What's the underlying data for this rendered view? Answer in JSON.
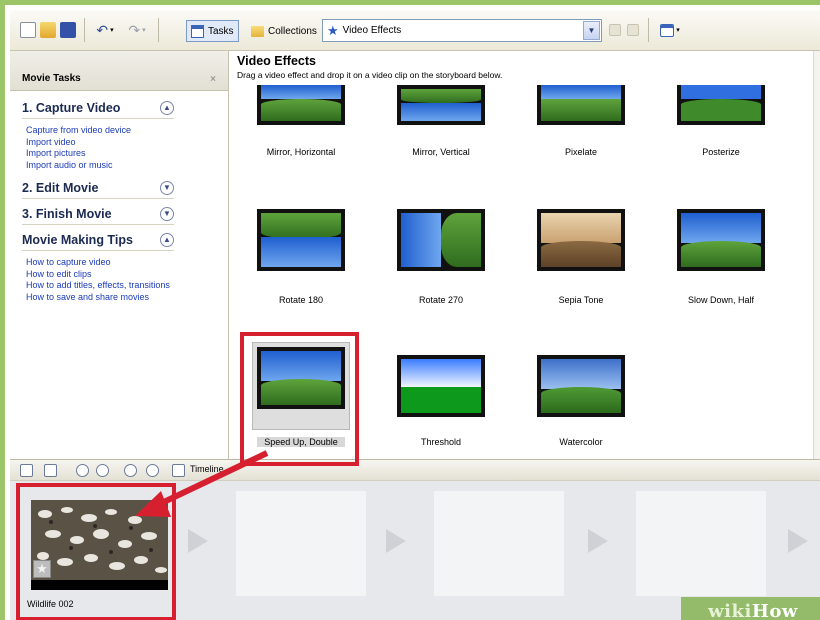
{
  "toolbar": {
    "tasks_label": "Tasks",
    "collections_label": "Collections",
    "collection_selected": "Video Effects",
    "icons": [
      "new-project-icon",
      "open-icon",
      "save-icon",
      "undo-icon",
      "redo-icon",
      "tasks-icon",
      "collections-icon",
      "video-effects-icon",
      "up-folder-icon",
      "new-folder-icon",
      "views-icon"
    ]
  },
  "tasks_pane": {
    "header": "Movie Tasks",
    "sections": [
      {
        "title": "1. Capture Video",
        "expanded": true,
        "links": [
          "Capture from video device",
          "Import video",
          "Import pictures",
          "Import audio or music"
        ]
      },
      {
        "title": "2. Edit Movie",
        "expanded": false,
        "links": []
      },
      {
        "title": "3. Finish Movie",
        "expanded": false,
        "links": []
      },
      {
        "title": "Movie Making Tips",
        "expanded": true,
        "links": [
          "How to capture video",
          "How to edit clips",
          "How to add titles, effects, transitions",
          "How to save and share movies"
        ]
      }
    ]
  },
  "effects_pane": {
    "title": "Video Effects",
    "subtitle": "Drag a video effect and drop it on a video clip on the storyboard below.",
    "effects": [
      {
        "label": "Mirror, Horizontal"
      },
      {
        "label": "Mirror, Vertical"
      },
      {
        "label": "Pixelate"
      },
      {
        "label": "Posterize"
      },
      {
        "label": "Rotate 180"
      },
      {
        "label": "Rotate 270"
      },
      {
        "label": "Sepia Tone"
      },
      {
        "label": "Slow Down, Half"
      },
      {
        "label": "Speed Up, Double",
        "selected": true
      },
      {
        "label": "Threshold"
      },
      {
        "label": "Watercolor"
      }
    ]
  },
  "timeline": {
    "label": "Timeline",
    "clip_label": "Wildlife 002"
  },
  "watermark": {
    "wiki": "wiki",
    "how": "How"
  },
  "colors": {
    "highlight": "#d61f2f",
    "frame": "#9cc56a",
    "link": "#1b3bb7"
  }
}
